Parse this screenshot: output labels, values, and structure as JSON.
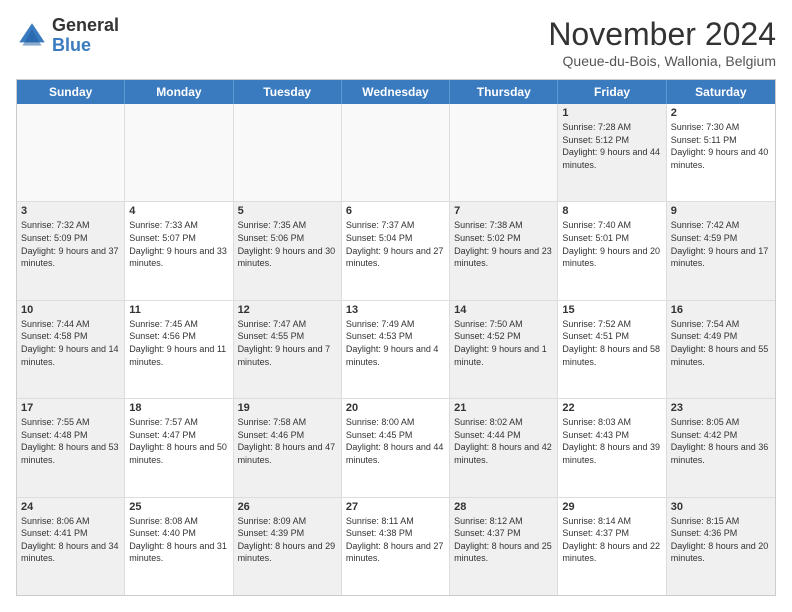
{
  "logo": {
    "general": "General",
    "blue": "Blue"
  },
  "title": "November 2024",
  "location": "Queue-du-Bois, Wallonia, Belgium",
  "header_days": [
    "Sunday",
    "Monday",
    "Tuesday",
    "Wednesday",
    "Thursday",
    "Friday",
    "Saturday"
  ],
  "rows": [
    [
      {
        "day": "",
        "info": "",
        "empty": true
      },
      {
        "day": "",
        "info": "",
        "empty": true
      },
      {
        "day": "",
        "info": "",
        "empty": true
      },
      {
        "day": "",
        "info": "",
        "empty": true
      },
      {
        "day": "",
        "info": "",
        "empty": true
      },
      {
        "day": "1",
        "info": "Sunrise: 7:28 AM\nSunset: 5:12 PM\nDaylight: 9 hours and 44 minutes.",
        "shaded": true
      },
      {
        "day": "2",
        "info": "Sunrise: 7:30 AM\nSunset: 5:11 PM\nDaylight: 9 hours and 40 minutes.",
        "shaded": false
      }
    ],
    [
      {
        "day": "3",
        "info": "Sunrise: 7:32 AM\nSunset: 5:09 PM\nDaylight: 9 hours and 37 minutes.",
        "shaded": true
      },
      {
        "day": "4",
        "info": "Sunrise: 7:33 AM\nSunset: 5:07 PM\nDaylight: 9 hours and 33 minutes.",
        "shaded": false
      },
      {
        "day": "5",
        "info": "Sunrise: 7:35 AM\nSunset: 5:06 PM\nDaylight: 9 hours and 30 minutes.",
        "shaded": true
      },
      {
        "day": "6",
        "info": "Sunrise: 7:37 AM\nSunset: 5:04 PM\nDaylight: 9 hours and 27 minutes.",
        "shaded": false
      },
      {
        "day": "7",
        "info": "Sunrise: 7:38 AM\nSunset: 5:02 PM\nDaylight: 9 hours and 23 minutes.",
        "shaded": true
      },
      {
        "day": "8",
        "info": "Sunrise: 7:40 AM\nSunset: 5:01 PM\nDaylight: 9 hours and 20 minutes.",
        "shaded": false
      },
      {
        "day": "9",
        "info": "Sunrise: 7:42 AM\nSunset: 4:59 PM\nDaylight: 9 hours and 17 minutes.",
        "shaded": true
      }
    ],
    [
      {
        "day": "10",
        "info": "Sunrise: 7:44 AM\nSunset: 4:58 PM\nDaylight: 9 hours and 14 minutes.",
        "shaded": true
      },
      {
        "day": "11",
        "info": "Sunrise: 7:45 AM\nSunset: 4:56 PM\nDaylight: 9 hours and 11 minutes.",
        "shaded": false
      },
      {
        "day": "12",
        "info": "Sunrise: 7:47 AM\nSunset: 4:55 PM\nDaylight: 9 hours and 7 minutes.",
        "shaded": true
      },
      {
        "day": "13",
        "info": "Sunrise: 7:49 AM\nSunset: 4:53 PM\nDaylight: 9 hours and 4 minutes.",
        "shaded": false
      },
      {
        "day": "14",
        "info": "Sunrise: 7:50 AM\nSunset: 4:52 PM\nDaylight: 9 hours and 1 minute.",
        "shaded": true
      },
      {
        "day": "15",
        "info": "Sunrise: 7:52 AM\nSunset: 4:51 PM\nDaylight: 8 hours and 58 minutes.",
        "shaded": false
      },
      {
        "day": "16",
        "info": "Sunrise: 7:54 AM\nSunset: 4:49 PM\nDaylight: 8 hours and 55 minutes.",
        "shaded": true
      }
    ],
    [
      {
        "day": "17",
        "info": "Sunrise: 7:55 AM\nSunset: 4:48 PM\nDaylight: 8 hours and 53 minutes.",
        "shaded": true
      },
      {
        "day": "18",
        "info": "Sunrise: 7:57 AM\nSunset: 4:47 PM\nDaylight: 8 hours and 50 minutes.",
        "shaded": false
      },
      {
        "day": "19",
        "info": "Sunrise: 7:58 AM\nSunset: 4:46 PM\nDaylight: 8 hours and 47 minutes.",
        "shaded": true
      },
      {
        "day": "20",
        "info": "Sunrise: 8:00 AM\nSunset: 4:45 PM\nDaylight: 8 hours and 44 minutes.",
        "shaded": false
      },
      {
        "day": "21",
        "info": "Sunrise: 8:02 AM\nSunset: 4:44 PM\nDaylight: 8 hours and 42 minutes.",
        "shaded": true
      },
      {
        "day": "22",
        "info": "Sunrise: 8:03 AM\nSunset: 4:43 PM\nDaylight: 8 hours and 39 minutes.",
        "shaded": false
      },
      {
        "day": "23",
        "info": "Sunrise: 8:05 AM\nSunset: 4:42 PM\nDaylight: 8 hours and 36 minutes.",
        "shaded": true
      }
    ],
    [
      {
        "day": "24",
        "info": "Sunrise: 8:06 AM\nSunset: 4:41 PM\nDaylight: 8 hours and 34 minutes.",
        "shaded": true
      },
      {
        "day": "25",
        "info": "Sunrise: 8:08 AM\nSunset: 4:40 PM\nDaylight: 8 hours and 31 minutes.",
        "shaded": false
      },
      {
        "day": "26",
        "info": "Sunrise: 8:09 AM\nSunset: 4:39 PM\nDaylight: 8 hours and 29 minutes.",
        "shaded": true
      },
      {
        "day": "27",
        "info": "Sunrise: 8:11 AM\nSunset: 4:38 PM\nDaylight: 8 hours and 27 minutes.",
        "shaded": false
      },
      {
        "day": "28",
        "info": "Sunrise: 8:12 AM\nSunset: 4:37 PM\nDaylight: 8 hours and 25 minutes.",
        "shaded": true
      },
      {
        "day": "29",
        "info": "Sunrise: 8:14 AM\nSunset: 4:37 PM\nDaylight: 8 hours and 22 minutes.",
        "shaded": false
      },
      {
        "day": "30",
        "info": "Sunrise: 8:15 AM\nSunset: 4:36 PM\nDaylight: 8 hours and 20 minutes.",
        "shaded": true
      }
    ]
  ]
}
